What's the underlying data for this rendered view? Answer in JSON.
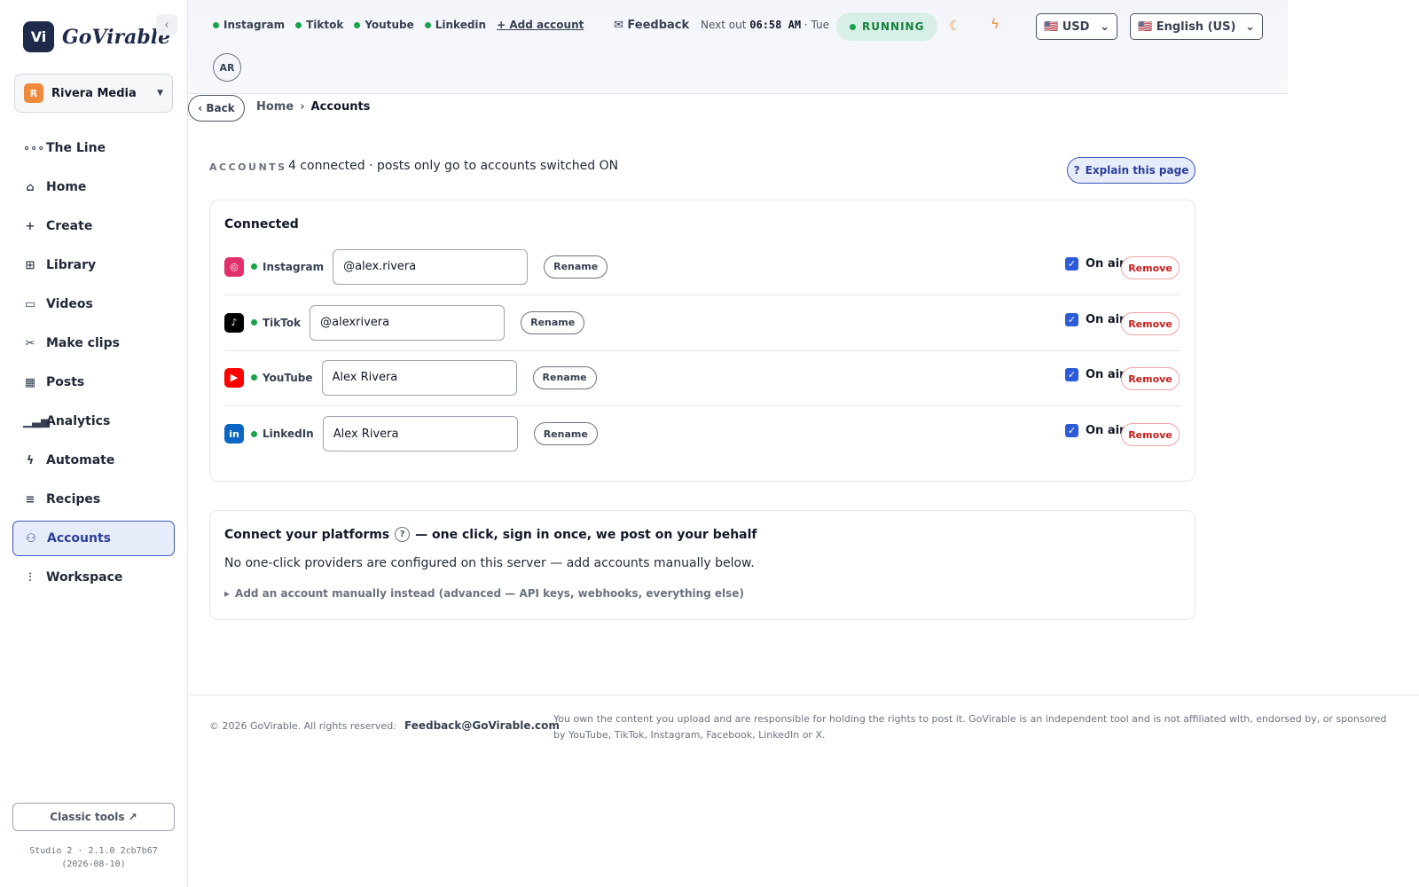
{
  "brand": {
    "logo_mark": "Vi",
    "name": "GoVirable",
    "collapse_icon": "‹"
  },
  "workspace": {
    "initial": "R",
    "name": "Rivera Media"
  },
  "nav": [
    {
      "label": "The Line",
      "icon": "dots-icon",
      "glyph": "∘∘∘"
    },
    {
      "label": "Home",
      "icon": "home-icon",
      "glyph": "⌂"
    },
    {
      "label": "Create",
      "icon": "plus-icon",
      "glyph": "+"
    },
    {
      "label": "Library",
      "icon": "grid-icon",
      "glyph": "⊞"
    },
    {
      "label": "Videos",
      "icon": "video-icon",
      "glyph": "▭"
    },
    {
      "label": "Make clips",
      "icon": "scissors-icon",
      "glyph": "✂"
    },
    {
      "label": "Posts",
      "icon": "calendar-icon",
      "glyph": "▦"
    },
    {
      "label": "Analytics",
      "icon": "bar-chart-icon",
      "glyph": "▁▃▅"
    },
    {
      "label": "Automate",
      "icon": "bolt-icon",
      "glyph": "ϟ"
    },
    {
      "label": "Recipes",
      "icon": "document-icon",
      "glyph": "≡"
    },
    {
      "label": "Accounts",
      "icon": "users-icon",
      "glyph": "⚇"
    },
    {
      "label": "Workspace",
      "icon": "sliders-icon",
      "glyph": "⫶"
    }
  ],
  "sidebar_footer": {
    "classic_tools": "Classic tools ↗",
    "version_line1": "Studio 2 · 2.1.0 2cb7b67",
    "version_line2": "(2026-08-10)"
  },
  "topbar": {
    "platform_chips": [
      "Instagram",
      "Tiktok",
      "Youtube",
      "Linkedin"
    ],
    "add_account": "+ Add account",
    "feedback": "✉ Feedback",
    "next_out_label": "Next out",
    "next_out_time": "06:58 AM",
    "next_out_day": "· Tue",
    "status": "RUNNING",
    "currency": "🇺🇸 USD",
    "language": "🇺🇸 English (US)",
    "user_initials": "AR"
  },
  "breadcrumb": {
    "back": "‹ Back",
    "home": "Home",
    "separator": "›",
    "current": "Accounts"
  },
  "header": {
    "eyebrow": "ACCOUNTS",
    "subtitle": "4 connected · posts only go to accounts switched ON",
    "explain": "Explain this page",
    "explain_icon": "?"
  },
  "connected": {
    "title": "Connected",
    "rename_label": "Rename",
    "on_air_label": "On air",
    "remove_label": "Remove",
    "accounts": [
      {
        "platform": "Instagram",
        "handle": "@alex.rivera",
        "icon_glyph": "◎",
        "color": "#e1306c",
        "on_air": true
      },
      {
        "platform": "TikTok",
        "handle": "@alexrivera",
        "icon_glyph": "♪",
        "color": "#000000",
        "on_air": true
      },
      {
        "platform": "YouTube",
        "handle": "Alex Rivera",
        "icon_glyph": "▶",
        "color": "#ff0000",
        "on_air": true
      },
      {
        "platform": "LinkedIn",
        "handle": "Alex Rivera",
        "icon_glyph": "in",
        "color": "#0a66c2",
        "on_air": true
      }
    ]
  },
  "connect": {
    "title": "Connect your platforms",
    "help_icon": "?",
    "title_suffix": "— one click, sign in once, we post on your behalf",
    "body": "No one-click providers are configured on this server — add accounts manually below.",
    "advanced": "Add an account manually instead (advanced — API keys, webhooks, everything else)"
  },
  "footer": {
    "copyright": "© 2026 GoVirable. All rights reserved.",
    "separator": "·",
    "email": "Feedback@GoVirable.com",
    "disclaimer": "You own the content you upload and are responsible for holding the rights to post it. GoVirable is an independent tool and is not affiliated with, endorsed by, or sponsored by YouTube, TikTok, Instagram, Facebook, LinkedIn or X."
  }
}
